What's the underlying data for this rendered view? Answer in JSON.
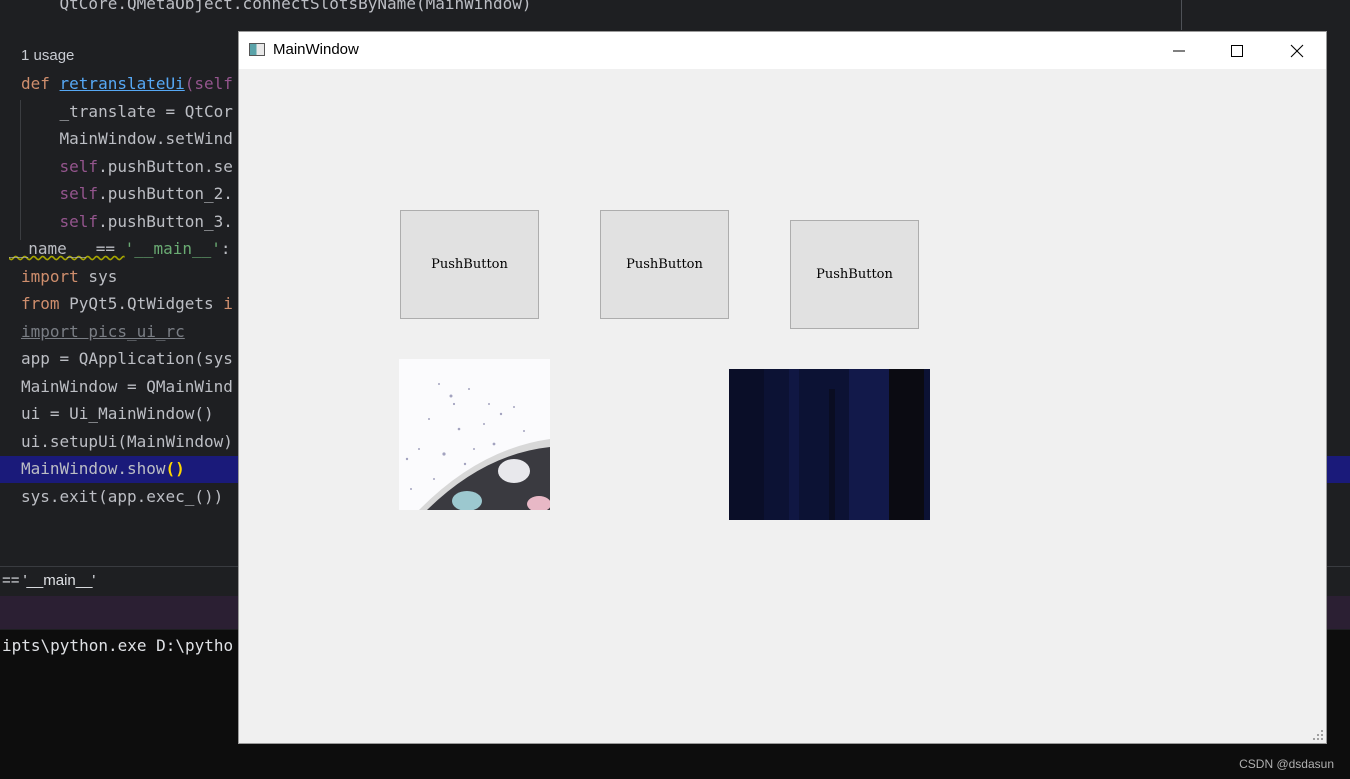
{
  "ide": {
    "code_top_partial": "    QtCore.QMetaObject.connectSlotsByName(MainWindow)",
    "usage_hint": "1 usage",
    "lines": [
      {
        "pre": "",
        "kw": "def ",
        "fn": "retranslateUi",
        "rest": "(self",
        "self": ""
      },
      {
        "text": "    _translate = QtCor"
      },
      {
        "text": "    MainWindow.setWind"
      },
      {
        "self": "    self",
        "text": ".pushButton.se"
      },
      {
        "self": "    self",
        "text": ".pushButton_2."
      },
      {
        "self": "    self",
        "text": ".pushButton_3."
      }
    ],
    "main_guard": {
      "pre": "__name__ == ",
      "str": "'__main__'",
      "post": ":"
    },
    "import_sys": {
      "kw": "import",
      "rest": " sys"
    },
    "from_line": {
      "kw": "from",
      "rest": " PyQt5.QtWidgets ",
      "kw2": "i"
    },
    "import_pics": "import pics_ui_rc",
    "app_line": "app = QApplication(sys",
    "mainwindow_line": "MainWindow = QMainWind",
    "ui_line": "ui = Ui_MainWindow()",
    "setup_line": "ui.setupUi(MainWindow)",
    "show_line": "MainWindow.show",
    "show_parens": "()",
    "exit_line": "sys.exit(app.exec_())",
    "breadcrumb": "== '__main__'",
    "console_line": "ipts\\python.exe D:\\pytho"
  },
  "window": {
    "title": "MainWindow",
    "buttons": [
      {
        "label": "PushButton"
      },
      {
        "label": "PushButton"
      },
      {
        "label": "PushButton"
      }
    ]
  },
  "watermark": "CSDN @dsdasun"
}
